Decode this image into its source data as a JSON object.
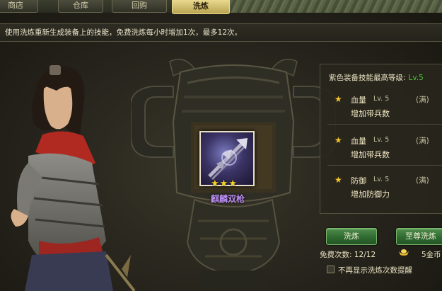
{
  "tabs": [
    {
      "label": "商店",
      "active": false
    },
    {
      "label": "仓库",
      "active": false
    },
    {
      "label": "回购",
      "active": false
    },
    {
      "label": "洗炼",
      "active": true
    }
  ],
  "description": "使用洗炼重新生成装备上的技能，免费洗炼每小时增加1次，最多12次。",
  "item": {
    "name": "麒麟双枪",
    "stars": 3,
    "icon": "twin-spear-weapon-icon"
  },
  "panel": {
    "title": "紫色装备技能最高等级:",
    "max_level": "Lv.5",
    "skills": [
      {
        "name": "血量",
        "level": "Lv. 5",
        "status": "(满)",
        "effect": "增加带兵数"
      },
      {
        "name": "血量",
        "level": "Lv. 5",
        "status": "(满)",
        "effect": "增加带兵数"
      },
      {
        "name": "防御",
        "level": "Lv. 5",
        "status": "(满)",
        "effect": "增加防御力"
      }
    ]
  },
  "buttons": {
    "refine": "洗炼",
    "supreme_refine": "至尊洗炼"
  },
  "free_count": "免费次数: 12/12",
  "gold_cost": "5金币",
  "no_reminder_label": "不再显示洗炼次数提醒",
  "colors": {
    "accent_gold": "#e9d98f",
    "item_name_purple": "#b98df0",
    "level_green": "#4fc33a",
    "button_green": "#2f6b31"
  }
}
